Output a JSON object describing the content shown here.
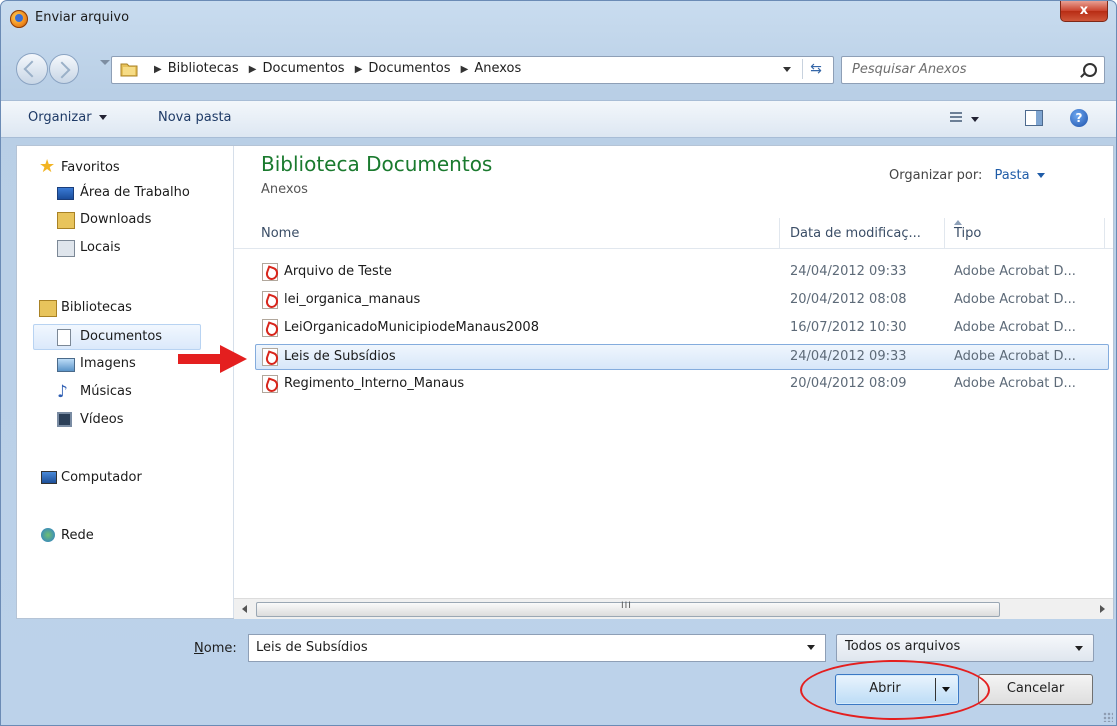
{
  "window": {
    "title": "Enviar arquivo",
    "close_label": "x"
  },
  "address": {
    "breadcrumbs": [
      "Bibliotecas",
      "Documentos",
      "Documentos",
      "Anexos"
    ],
    "search_placeholder": "Pesquisar Anexos"
  },
  "toolbar": {
    "organize": "Organizar",
    "new_folder": "Nova pasta"
  },
  "nav": {
    "favorites": "Favoritos",
    "desktop": "Área de Trabalho",
    "downloads": "Downloads",
    "places": "Locais",
    "libraries": "Bibliotecas",
    "documents": "Documentos",
    "images": "Imagens",
    "music": "Músicas",
    "videos": "Vídeos",
    "computer": "Computador",
    "network": "Rede"
  },
  "library": {
    "title": "Biblioteca Documentos",
    "subtitle": "Anexos",
    "arrange_label": "Organizar por:",
    "arrange_value": "Pasta"
  },
  "columns": {
    "name": "Nome",
    "date": "Data de modificaç...",
    "type": "Tipo"
  },
  "files": [
    {
      "name": "Arquivo de Teste",
      "date": "24/04/2012 09:33",
      "type": "Adobe Acrobat D..."
    },
    {
      "name": "lei_organica_manaus",
      "date": "20/04/2012 08:08",
      "type": "Adobe Acrobat D..."
    },
    {
      "name": "LeiOrganicadoMunicipiodeManaus2008",
      "date": "16/07/2012 10:30",
      "type": "Adobe Acrobat D..."
    },
    {
      "name": "Leis de Subsídios",
      "date": "24/04/2012 09:33",
      "type": "Adobe Acrobat D..."
    },
    {
      "name": "Regimento_Interno_Manaus",
      "date": "20/04/2012 08:09",
      "type": "Adobe Acrobat D..."
    }
  ],
  "selected_file_index": 3,
  "scrollbar": {
    "grip": "III"
  },
  "form": {
    "name_label": "ome:",
    "name_label_hotkey": "N",
    "name_value": "Leis de Subsídios",
    "type_value": "Todos os arquivos",
    "open_label": "Abrir",
    "cancel_label": "Cancelar"
  },
  "annotation": {
    "color": "#e41f1f"
  }
}
